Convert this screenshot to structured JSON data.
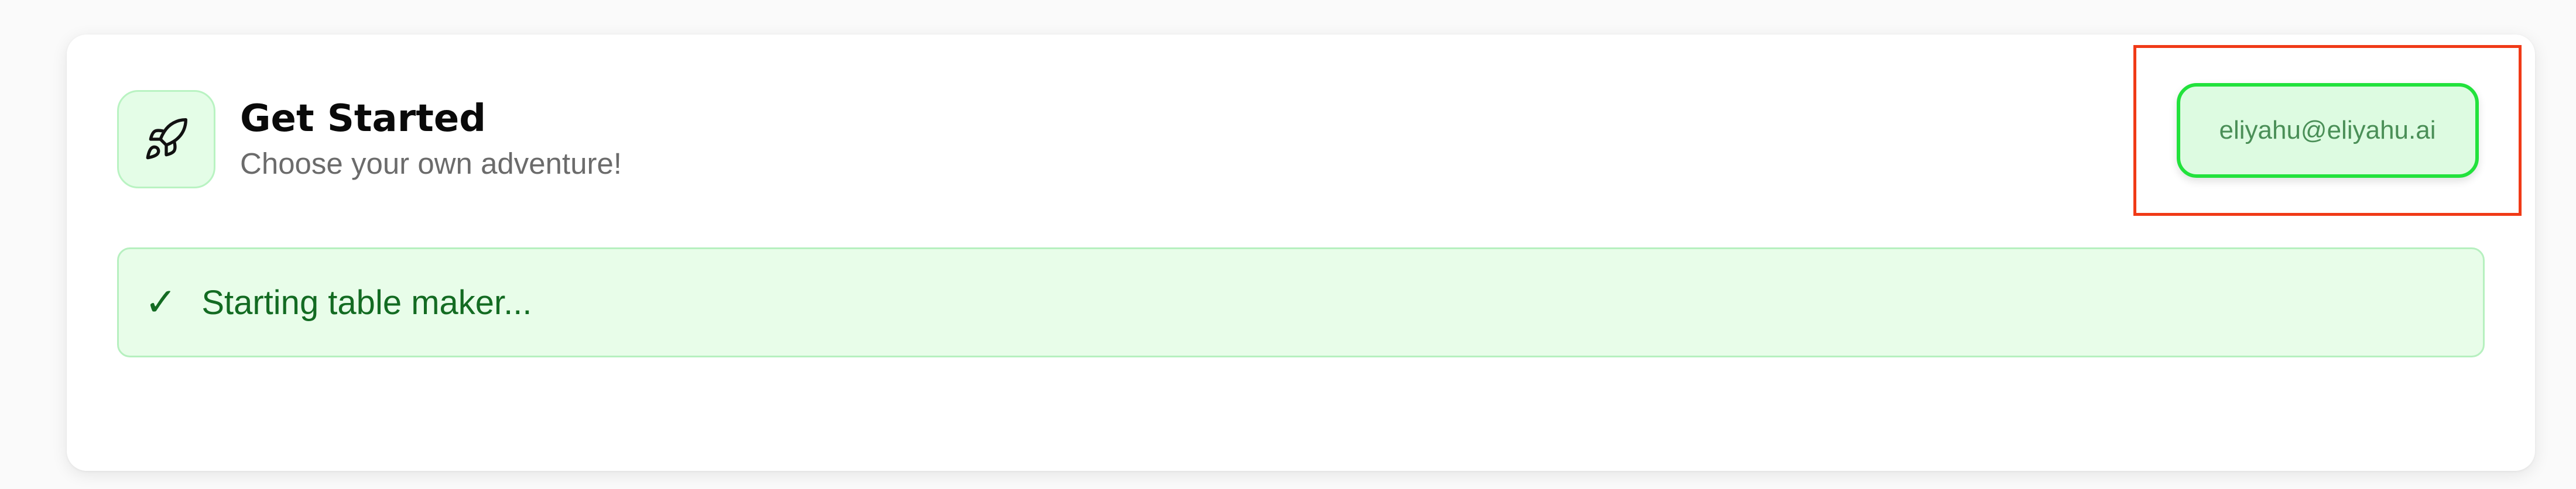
{
  "header": {
    "title": "Get Started",
    "subtitle": "Choose your own adventure!",
    "icon": "rocket-icon"
  },
  "account": {
    "email": "eliyahu@eliyahu.ai"
  },
  "status": {
    "icon": "check-icon",
    "symbol": "✓",
    "message": "Starting table maker..."
  },
  "colors": {
    "accent_green": "#22e23c",
    "status_text": "#136b22",
    "highlight_red": "#f03a17"
  }
}
